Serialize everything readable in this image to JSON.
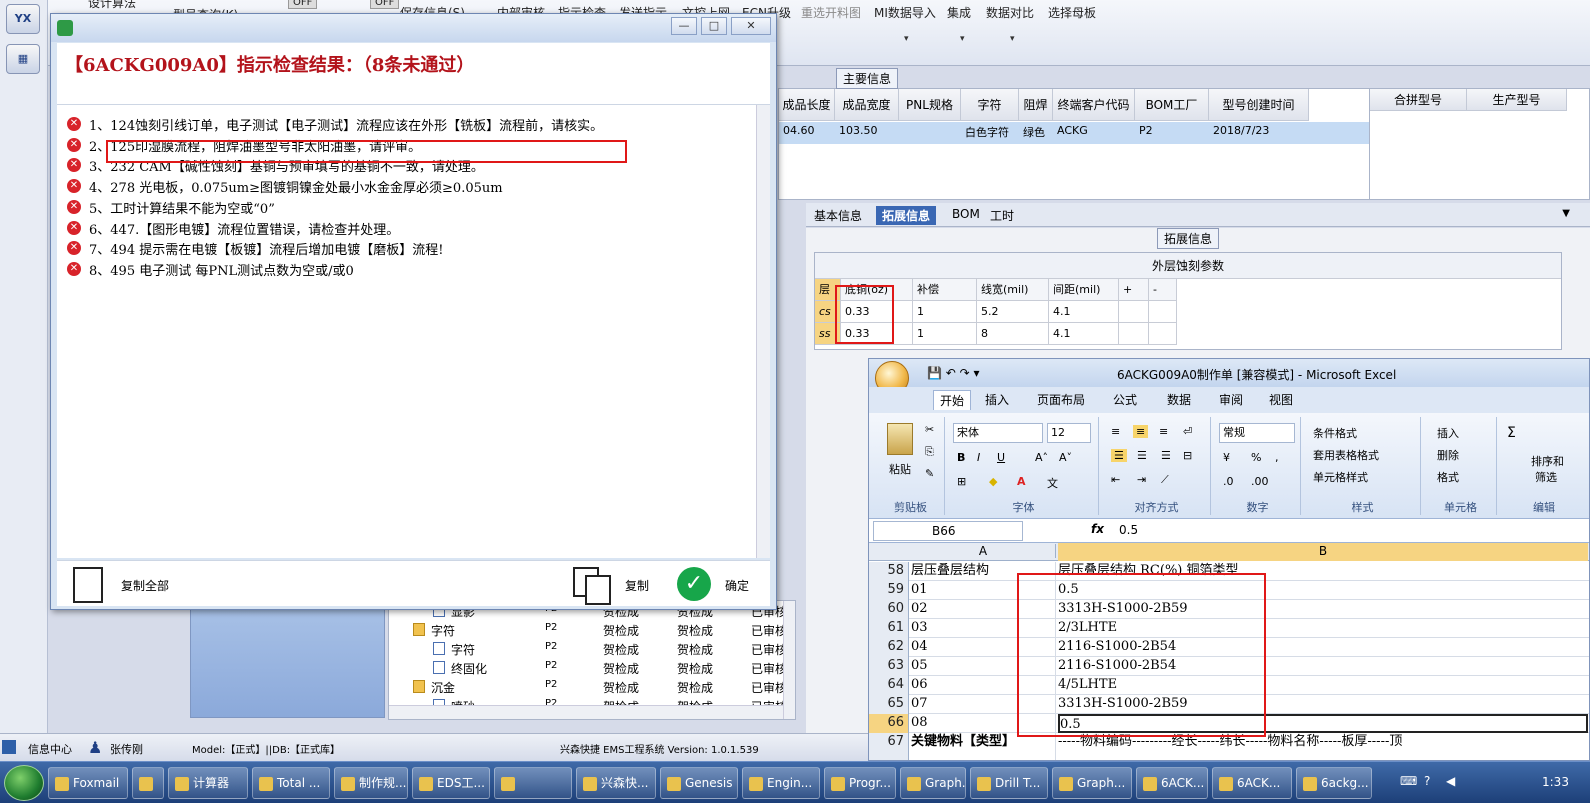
{
  "left_strip": {
    "icon1": "YX",
    "icon2": "▦"
  },
  "topbar": {
    "partial_top": "设计算法",
    "type_query": "型号查询(K)",
    "off1": "OFF",
    "off2": "OFF",
    "menu": [
      {
        "label": "保存信息(S)",
        "disabled": false
      },
      {
        "label": "内部审核",
        "disabled": false
      },
      {
        "label": "指示检查",
        "disabled": false
      },
      {
        "label": "发送指示",
        "disabled": false
      },
      {
        "label": "文控上网",
        "disabled": false
      },
      {
        "label": "ECN升级",
        "disabled": false
      },
      {
        "label": "重选开料图",
        "disabled": true
      },
      {
        "label": "MI数据导入",
        "disabled": false
      },
      {
        "label": "集成",
        "disabled": false
      },
      {
        "label": "数据对比",
        "disabled": false
      },
      {
        "label": "选择母板",
        "disabled": false
      }
    ]
  },
  "main_info": {
    "title": "主要信息",
    "headers": [
      "成品长度",
      "成品宽度",
      "PNL规格",
      "字符",
      "阻焊",
      "终端客户代码",
      "BOM工厂",
      "型号创建时间"
    ],
    "row": [
      "04.60",
      "103.50",
      "",
      "白色字符",
      "绿色",
      "ACKG",
      "P2",
      "2018/7/23"
    ],
    "side_headers": [
      "合拼型号",
      "生产型号"
    ]
  },
  "detail_tabs": [
    "基本信息",
    "拓展信息",
    "BOM",
    "工时"
  ],
  "ext": {
    "title": "拓展信息",
    "sub_title": "外层蚀刻参数",
    "columns": [
      "层",
      "底铜(oz)",
      "补偿",
      "线宽(mil)",
      "间距(mil)",
      "+",
      "-"
    ],
    "rows": [
      [
        "cs",
        "0.33",
        "1",
        "5.2",
        "4.1",
        "",
        ""
      ],
      [
        "ss",
        "0.33",
        "1",
        "8",
        "4.1",
        "",
        ""
      ]
    ]
  },
  "tree": [
    {
      "name": "显影",
      "factory": "P2",
      "c1": "贺检成",
      "c2": "贺检成",
      "c3": "已审核",
      "kind": "file"
    },
    {
      "name": "字符",
      "factory": "P2",
      "c1": "贺检成",
      "c2": "贺检成",
      "c3": "已审核",
      "kind": "folder"
    },
    {
      "name": "字符",
      "factory": "P2",
      "c1": "贺检成",
      "c2": "贺检成",
      "c3": "已审核",
      "kind": "file"
    },
    {
      "name": "终固化",
      "factory": "P2",
      "c1": "贺检成",
      "c2": "贺检成",
      "c3": "已审核",
      "kind": "file"
    },
    {
      "name": "沉金",
      "factory": "P2",
      "c1": "贺检成",
      "c2": "贺检成",
      "c3": "已审核",
      "kind": "folder"
    },
    {
      "name": "喷砂",
      "factory": "P2",
      "c1": "贺检成",
      "c2": "贺检成",
      "c3": "已审核",
      "kind": "file"
    }
  ],
  "status": {
    "info_center": "信息中心",
    "user": "张传刚",
    "model": "Model:【正式】||DB:【正式库】",
    "app": "兴森快捷 EMS工程系统 Version: 1.0.1.539"
  },
  "dialog": {
    "title": "【6ACKG009A0】指示检查结果：（8条未通过）",
    "messages": [
      "1、124蚀刻引线订单，电子测试【电子测试】流程应该在外形【铣板】流程前，请核实。",
      "2、125印湿膜流程，阻焊油墨型号非太阳油墨，请评审。",
      "3、232 CAM【碱性蚀刻】基铜与预审填写的基铜不一致，请处理。",
      "4、278 光电板，0.075um≥图镀铜镍金处最小水金金厚必须≥0.05um",
      "5、工时计算结果不能为空或“0”",
      "6、447.【图形电镀】流程位置错误，请检查并处理。",
      "7、494 提示需在电镀【板镀】流程后增加电镀【磨板】流程!",
      "8、495 电子测试 每PNL测试点数为空或/或0"
    ],
    "copy_all": "复制全部",
    "copy": "复制",
    "ok": "确定"
  },
  "excel": {
    "title": "6ACKG009A0制作单 [兼容模式] - Microsoft Excel",
    "tabs": [
      "开始",
      "插入",
      "页面布局",
      "公式",
      "数据",
      "审阅",
      "视图"
    ],
    "font_name": "宋体",
    "font_size": "12",
    "number_format": "常规",
    "groups": [
      "剪贴板",
      "字体",
      "对齐方式",
      "数字",
      "样式",
      "单元格",
      "编辑"
    ],
    "paste": "粘贴",
    "style_buttons": [
      "条件格式",
      "套用表格格式",
      "单元格样式"
    ],
    "cell_buttons": [
      "插入",
      "删除",
      "格式"
    ],
    "edit_buttons": [
      "排序和",
      "筛选"
    ],
    "name_box": "B66",
    "formula": "0.5",
    "col_a": "A",
    "col_b": "B",
    "rows": [
      {
        "n": "58",
        "a": "层压叠层结构",
        "b": "层压叠层结构   RC(%)    铜箔类型"
      },
      {
        "n": "59",
        "a": "01",
        "b": "0.5"
      },
      {
        "n": "60",
        "a": "02",
        "b": "3313H-S1000-2B59"
      },
      {
        "n": "61",
        "a": "03",
        "b": "2/3LHTE"
      },
      {
        "n": "62",
        "a": "04",
        "b": "2116-S1000-2B54"
      },
      {
        "n": "63",
        "a": "05",
        "b": "2116-S1000-2B54"
      },
      {
        "n": "64",
        "a": "06",
        "b": "4/5LHTE"
      },
      {
        "n": "65",
        "a": "07",
        "b": "3313H-S1000-2B59"
      },
      {
        "n": "66",
        "a": "08",
        "b": "0.5"
      },
      {
        "n": "67",
        "a": "关键物料【类型】",
        "b": "-----物料编码---------经长-----纬长-----物料名称-----板厚-----顶"
      }
    ]
  },
  "taskbar": {
    "buttons": [
      "Foxmail",
      "",
      "计算器",
      "Total ...",
      "制作规...",
      "EDS工...",
      "",
      "兴森快...",
      "Genesis",
      "Engin...",
      "Progr...",
      "Graph...",
      "Drill T...",
      "Graph...",
      "6ACK...",
      "6ACK...",
      "6ackg..."
    ],
    "time": "1:33"
  }
}
